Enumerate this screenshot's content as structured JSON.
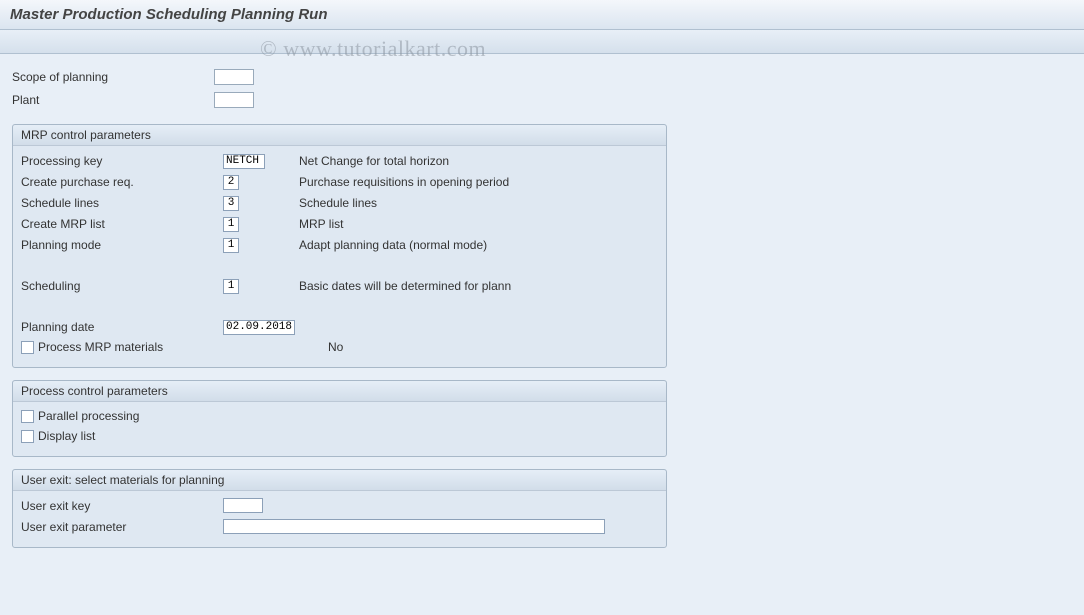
{
  "title": "Master Production Scheduling Planning Run",
  "watermark": "© www.tutorialkart.com",
  "top": {
    "scope_label": "Scope of planning",
    "scope_value": "",
    "plant_label": "Plant",
    "plant_value": ""
  },
  "mrp": {
    "heading": "MRP control parameters",
    "rows": {
      "processing_key": {
        "label": "Processing key",
        "value": "NETCH",
        "desc": "Net Change for total horizon"
      },
      "create_pr": {
        "label": "Create purchase req.",
        "value": "2",
        "desc": "Purchase requisitions in opening period"
      },
      "schedule_lines": {
        "label": "Schedule lines",
        "value": "3",
        "desc": "Schedule lines"
      },
      "create_mrp": {
        "label": "Create MRP list",
        "value": "1",
        "desc": "MRP list"
      },
      "planning_mode": {
        "label": "Planning mode",
        "value": "1",
        "desc": "Adapt planning data (normal mode)"
      },
      "scheduling": {
        "label": "Scheduling",
        "value": "1",
        "desc": "Basic dates will be determined for plann"
      },
      "planning_date": {
        "label": "Planning date",
        "value": "02.09.2018",
        "desc": ""
      }
    },
    "process_mrp_label": "Process MRP materials",
    "process_mrp_desc": "No"
  },
  "pcp": {
    "heading": "Process control parameters",
    "parallel_label": "Parallel processing",
    "display_label": "Display list"
  },
  "uex": {
    "heading": "User exit: select materials for planning",
    "key_label": "User exit key",
    "key_value": "",
    "param_label": "User exit parameter",
    "param_value": ""
  }
}
